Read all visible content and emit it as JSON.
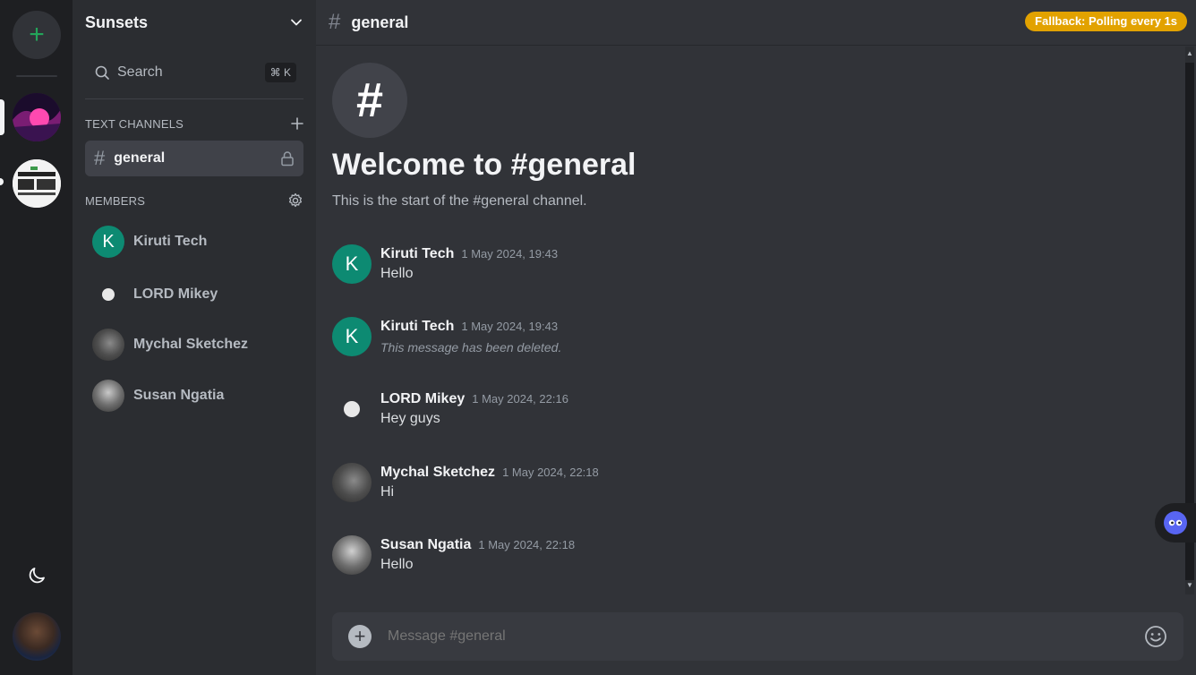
{
  "server": {
    "name": "Sunsets"
  },
  "search": {
    "placeholder": "Search",
    "shortcut": "⌘ K"
  },
  "sections": {
    "text_channels": "TEXT CHANNELS",
    "members": "MEMBERS"
  },
  "channels": [
    {
      "name": "general",
      "locked": true,
      "selected": true
    }
  ],
  "members": [
    {
      "name": "Kiruti Tech",
      "initial": "K"
    },
    {
      "name": "LORD Mikey"
    },
    {
      "name": "Mychal Sketchez"
    },
    {
      "name": "Susan Ngatia"
    }
  ],
  "header": {
    "channel": "general",
    "badge": "Fallback: Polling every 1s"
  },
  "welcome": {
    "icon": "#",
    "title": "Welcome to #general",
    "subtitle": "This is the start of the #general channel."
  },
  "messages": [
    {
      "author": "Kiruti Tech",
      "initial": "K",
      "time": "1 May 2024, 19:43",
      "text": "Hello"
    },
    {
      "author": "Kiruti Tech",
      "initial": "K",
      "time": "1 May 2024, 19:43",
      "text": "This message has been deleted."
    },
    {
      "author": "LORD Mikey",
      "time": "1 May 2024, 22:16",
      "text": "Hey guys"
    },
    {
      "author": "Mychal Sketchez",
      "time": "1 May 2024, 22:18",
      "text": "Hi"
    },
    {
      "author": "Susan Ngatia",
      "time": "1 May 2024, 22:18",
      "text": "Hello"
    }
  ],
  "composer": {
    "placeholder": "Message #general"
  },
  "colors": {
    "accent_green": "#23a55a",
    "badge": "#e2a200",
    "avatar_teal": "#0d8a72"
  }
}
